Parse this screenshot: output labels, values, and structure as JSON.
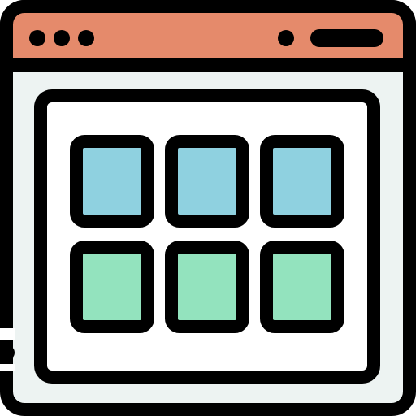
{
  "icon": {
    "name": "browser-window-grid-icon",
    "colors": {
      "outline": "#000000",
      "title_bar": "#E58A6B",
      "window_body": "#EDF3F2",
      "canvas": "#FFFFFF",
      "tile_top": "#8FD1E0",
      "tile_bottom": "#93E3BE"
    },
    "title_bar_dots": 3,
    "grid": {
      "rows": 2,
      "columns": 3
    }
  }
}
